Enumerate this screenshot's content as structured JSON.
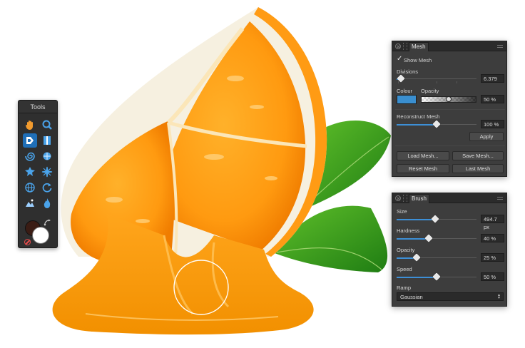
{
  "tools_panel": {
    "title": "Tools",
    "tools": [
      {
        "icon": "hand-icon"
      },
      {
        "icon": "zoom-icon"
      },
      {
        "icon": "push-forward-icon",
        "active": true
      },
      {
        "icon": "push-left-icon"
      },
      {
        "icon": "twirl-icon"
      },
      {
        "icon": "pinch-icon"
      },
      {
        "icon": "punch-icon"
      },
      {
        "icon": "turbulence-icon"
      },
      {
        "icon": "mesh-clone-icon"
      },
      {
        "icon": "reconstruct-icon"
      },
      {
        "icon": "freeze-icon"
      },
      {
        "icon": "thaw-icon"
      }
    ],
    "colors": {
      "primary": "#3a1c14",
      "secondary": "#ffffff",
      "accent": "#1f6fb8"
    }
  },
  "mesh_panel": {
    "tab": "Mesh",
    "show_mesh_label": "Show Mesh",
    "show_mesh_checked": true,
    "divisions_label": "Divisions",
    "divisions_value": "6.379",
    "divisions_fraction": 0.05,
    "colour_label": "Colour",
    "opacity_label": "Opacity",
    "mesh_colour": "#3a8fd0",
    "opacity_value": "50 %",
    "opacity_fraction": 0.5,
    "reconstruct_label": "Reconstruct Mesh",
    "reconstruct_value": "100 %",
    "reconstruct_fraction": 0.5,
    "apply_label": "Apply",
    "load_mesh_label": "Load Mesh...",
    "save_mesh_label": "Save Mesh...",
    "reset_mesh_label": "Reset Mesh",
    "last_mesh_label": "Last Mesh"
  },
  "brush_panel": {
    "tab": "Brush",
    "size_label": "Size",
    "size_value": "494.7 px",
    "size_fraction": 0.48,
    "hardness_label": "Hardness",
    "hardness_value": "40 %",
    "hardness_fraction": 0.4,
    "opacity_label": "Opacity",
    "opacity_value": "25 %",
    "opacity_fraction": 0.25,
    "speed_label": "Speed",
    "speed_value": "50 %",
    "speed_fraction": 0.5,
    "ramp_label": "Ramp",
    "ramp_value": "Gaussian"
  }
}
